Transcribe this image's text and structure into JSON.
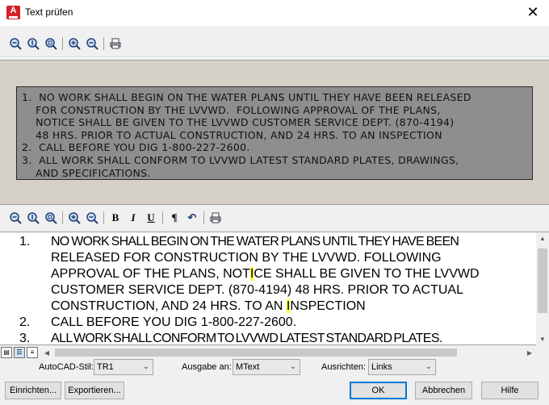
{
  "window": {
    "title": "Text prüfen",
    "close": "✕",
    "app_icon_letter": "A"
  },
  "preview": {
    "lines": [
      "1.  NO WORK SHALL BEGIN ON THE WATER PLANS UNTIL THEY HAVE BEEN RELEASED",
      "    FOR CONSTRUCTION BY THE LVVWD.  FOLLOWING APPROVAL OF THE PLANS,",
      "    NOTICE SHALL BE GIVEN TO THE LVVWD CUSTOMER SERVICE DEPT. (870-4194)",
      "    48 HRS. PRIOR TO ACTUAL CONSTRUCTION, AND 24 HRS. TO AN INSPECTION",
      "2.  CALL BEFORE YOU DIG 1-800-227-2600.",
      "3.  ALL WORK SHALL CONFORM TO LVVWD LATEST STANDARD PLATES, DRAWINGS,",
      "    AND SPECIFICATIONS."
    ]
  },
  "editor": {
    "n1": "1.",
    "l1": "NO WORK SHALL BEGIN ON THE WATER PLANS UNTIL THEY HAVE BEEN",
    "l2": "RELEASED FOR CONSTRUCTION BY THE LVVWD. FOLLOWING",
    "l3a": "APPROVAL OF THE PLANS, NOT",
    "l3hl": "I",
    "l3b": "CE SHALL BE GIVEN TO THE LVVWD",
    "l4": "CUSTOMER SERVICE DEPT. (870-4194) 48 HRS. PRIOR TO ACTUAL",
    "l5a": "CONSTRUCTION, AND 24 HRS. TO AN ",
    "l5hl": "I",
    "l5b": "NSPECTION",
    "n2": "2.",
    "l6": "CALL BEFORE YOU DIG 1-800-227-2600.",
    "n3": "3.",
    "l7": "ALL WORK SHALL CONFORM TO LVVWD LATEST STANDARD PLATES."
  },
  "format_toolbar": {
    "bold": "B",
    "italic": "I",
    "underline": "U",
    "pilcrow": "¶",
    "undo": "↶"
  },
  "options": {
    "style_label": "AutoCAD-Stil:",
    "style_value": "TR1",
    "output_label": "Ausgabe an:",
    "output_value": "MText",
    "align_label": "Ausrichten:",
    "align_value": "Links"
  },
  "buttons": {
    "setup": "Einrichten...",
    "export": "Exportieren...",
    "ok": "OK",
    "cancel": "Abbrechen",
    "help": "Hilfe"
  },
  "colors": {
    "highlight": "#ffff33",
    "accent": "#0078d7",
    "app_icon": "#d42026"
  }
}
